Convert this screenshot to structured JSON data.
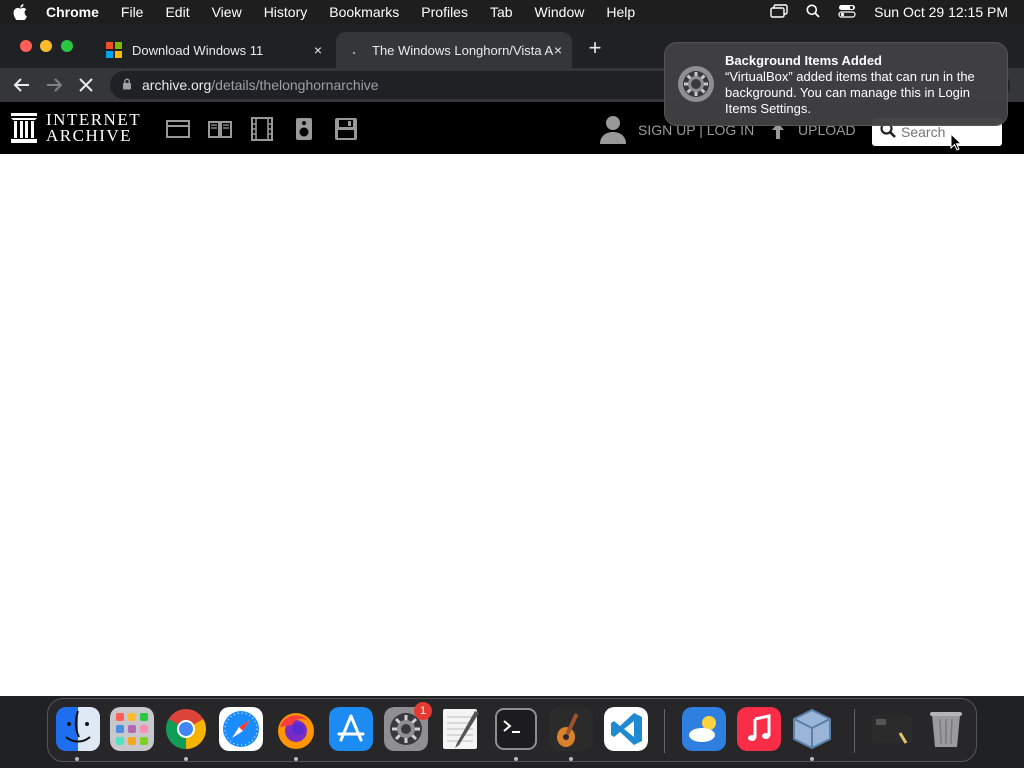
{
  "menubar": {
    "apple": "apple-icon",
    "app_name": "Chrome",
    "items": [
      "File",
      "Edit",
      "View",
      "History",
      "Bookmarks",
      "Profiles",
      "Tab",
      "Window",
      "Help"
    ],
    "clock": "Sun Oct 29  12:15 PM"
  },
  "tabs": [
    {
      "title": "Download Windows 11",
      "close": "×"
    },
    {
      "title": "The Windows Longhorn/Vista A",
      "close": "×"
    }
  ],
  "new_tab": "+",
  "omnibox": {
    "domain": "archive.org",
    "path": "/details/thelonghornarchive"
  },
  "ia": {
    "logo_line1": "INTERNET",
    "logo_line2": "ARCHIVE",
    "signup": "SIGN UP | LOG IN",
    "upload": "UPLOAD",
    "search_placeholder": "Search"
  },
  "notification": {
    "title": "Background Items Added",
    "body": "“VirtualBox” added items that can run in the background. You can manage this in Login Items Settings."
  },
  "dock": {
    "items": [
      "Finder",
      "Launchpad",
      "Chrome",
      "Safari",
      "Firefox",
      "App Store",
      "System Settings",
      "TextEdit",
      "Terminal",
      "GarageBand",
      "Visual Studio Code",
      "Weather",
      "Music",
      "VirtualBox",
      "Screenshot",
      "Trash"
    ],
    "badge": "1"
  },
  "colors": {
    "accent_close": "#ff5f57",
    "accent_min": "#febc2e",
    "accent_max": "#28c840"
  }
}
